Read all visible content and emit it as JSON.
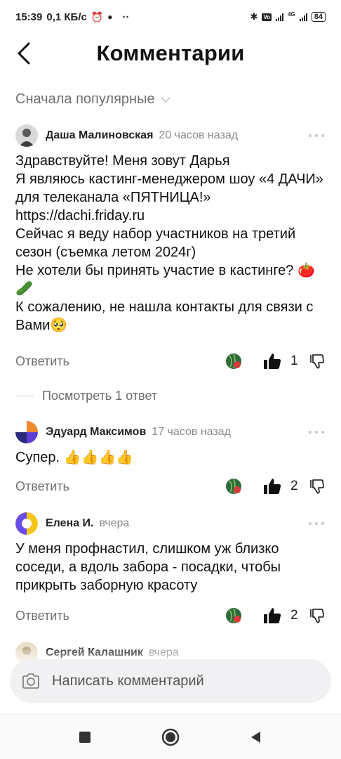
{
  "status_bar": {
    "time": "15:39",
    "speed": "0,1 КБ/с",
    "dots": "··",
    "network": "4G",
    "battery": "84"
  },
  "header": {
    "title": "Комментарии"
  },
  "sort": {
    "label": "Сначала популярные"
  },
  "comments": [
    {
      "author": "Даша Малиновская",
      "time": "20 часов назад",
      "text": "Здравствуйте! Меня зовут Дарья\nЯ являюсь кастинг-менеджером шоу «4 ДАЧИ» для телеканала «ПЯТНИЦА!»\nhttps://dachi.friday.ru\nСейчас я веду набор участников на третий сезон (съемка летом 2024г)\nНе хотели бы принять участие в кастинге? 🍅🥒\nК сожалению, не нашла контакты для связи с Вами🥺",
      "reply_label": "Ответить",
      "likes": "1"
    },
    {
      "author": "Эдуард Максимов",
      "time": "17 часов назад",
      "text": "Супер. 👍👍👍👍",
      "reply_label": "Ответить",
      "likes": "2"
    },
    {
      "author": "Елена И.",
      "time": "вчера",
      "text": "У меня профнастил, слишком уж близко соседи, а вдоль забора - посадки, чтобы прикрыть заборную красоту",
      "reply_label": "Ответить",
      "likes": "2"
    },
    {
      "author": "Сергей Калашник",
      "time": "вчера"
    }
  ],
  "thread": {
    "label": "Посмотреть 1 ответ"
  },
  "compose": {
    "placeholder": "Написать комментарий"
  },
  "colors": {
    "accent": "#111111",
    "muted": "#707070",
    "compose_bg": "#f1f1f3"
  }
}
